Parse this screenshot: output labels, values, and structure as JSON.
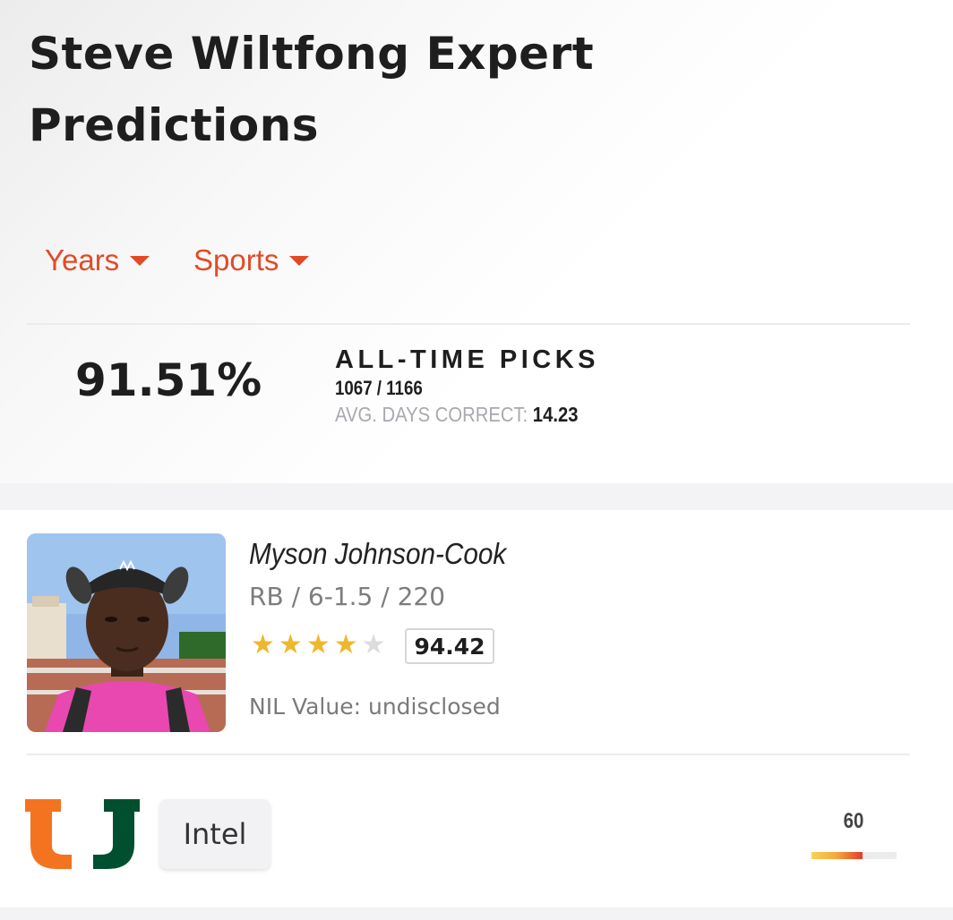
{
  "header": {
    "title": "Steve Wiltfong Expert Predictions"
  },
  "filters": [
    {
      "label": "Years"
    },
    {
      "label": "Sports"
    }
  ],
  "stats": {
    "percentage": "91.51%",
    "heading": "ALL-TIME PICKS",
    "record": "1067 / 1166",
    "avg_days_label": "AVG. DAYS CORRECT:",
    "avg_days_value": "14.23"
  },
  "player": {
    "name": "Myson Johnson-Cook",
    "meta": "RB / 6-1.5 / 220",
    "stars_filled": 4,
    "stars_total": 5,
    "rating": "94.42",
    "nil_label": "NIL Value:",
    "nil_value": "undisclosed"
  },
  "prediction": {
    "team_logo": "miami-u-logo",
    "intel_label": "Intel",
    "score": "60",
    "score_fraction": 0.6
  },
  "colors": {
    "accent": "#e24a26",
    "star": "#eeb72e",
    "logo_orange": "#f47321",
    "logo_green": "#005030"
  }
}
